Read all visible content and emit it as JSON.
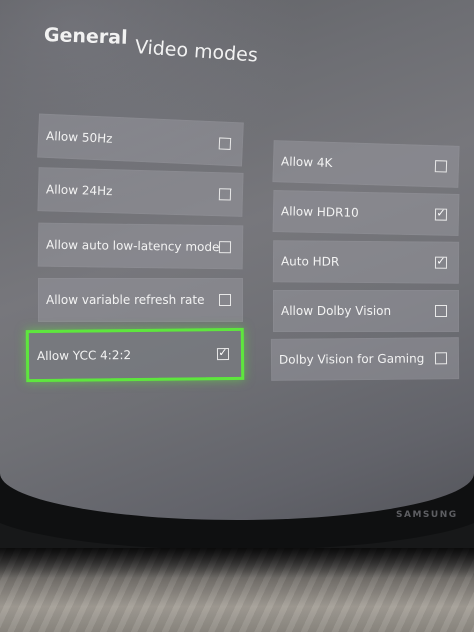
{
  "tabs": {
    "general": "General",
    "video_modes": "Video modes"
  },
  "options_left": [
    {
      "label": "Allow 50Hz",
      "checked": false
    },
    {
      "label": "Allow 24Hz",
      "checked": false
    },
    {
      "label": "Allow auto low-latency mode",
      "checked": false
    },
    {
      "label": "Allow variable refresh rate",
      "checked": false
    },
    {
      "label": "Allow YCC 4:2:2",
      "checked": true,
      "focused": true
    }
  ],
  "options_right": [
    {
      "label": "Allow 4K",
      "checked": false
    },
    {
      "label": "Allow HDR10",
      "checked": true
    },
    {
      "label": "Auto HDR",
      "checked": true
    },
    {
      "label": "Allow Dolby Vision",
      "checked": false
    },
    {
      "label": "Dolby Vision for Gaming",
      "checked": false
    }
  ],
  "monitor_brand": "SAMSUNG",
  "check_glyph": "✓",
  "colors": {
    "focus": "#5ee63e",
    "tile": "#96969c",
    "text": "#f3f3f3"
  }
}
